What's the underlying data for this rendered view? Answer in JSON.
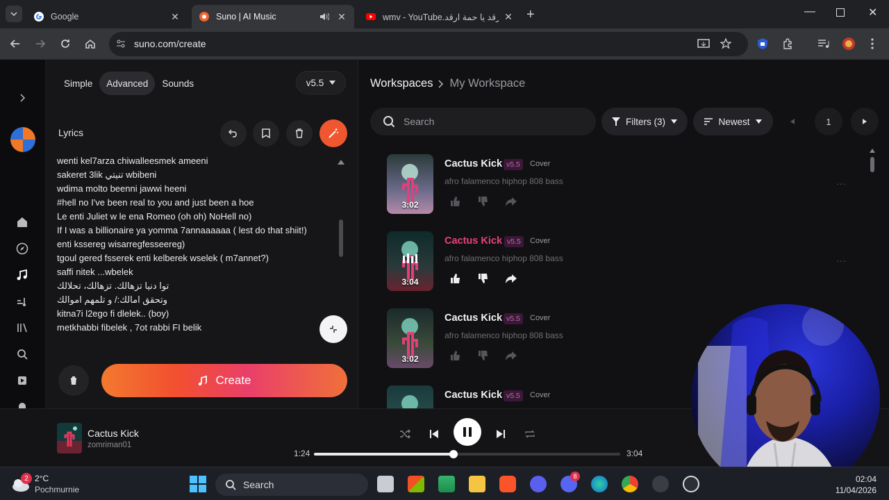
{
  "browser": {
    "tabs": [
      {
        "title": "Google",
        "active": false
      },
      {
        "title": "Suno | AI Music",
        "active": true
      },
      {
        "title": "wmv - YouTube.ارقد يا حمة ارقد",
        "active": false
      }
    ],
    "url": "suno.com/create"
  },
  "editor": {
    "modes": [
      "Simple",
      "Advanced",
      "Sounds"
    ],
    "active_mode": "Advanced",
    "version": "v5.5",
    "lyrics_label": "Lyrics",
    "lyrics_lines": [
      "wenti kel7arza chiwalleesmek ameeni",
      "sakeret 3lik تنيتي wbibeni",
      "wdima molto beenni jawwi heeni",
      "#hell no I've been real to you and just been a hoe",
      " Le enti Juliet w le ena Romeo (oh oh) NoHell no)",
      " If I was a billionaire ya yomma 7annaaaaaa ( lest do that shiit!)",
      "enti kssereg  wisarregfesseereg)",
      "tgoul gered fsserek enti kelberek wselek ( m7annet?)",
      "saffi nitek ...wbelek",
      "توا دنيا تزهالك. تزهالك، تحلالك",
      "وتحقق امالك:/ و تلمهم اموالك",
      " kitna7i l2ego fi dlelek.. (boy)",
      " metkhabbi fibelek  , 7ot rabbi FI belik"
    ],
    "create_label": "Create"
  },
  "workspace": {
    "breadcrumb_root": "Workspaces",
    "breadcrumb_current": "My Workspace",
    "search_placeholder": "Search",
    "filters_label": "Filters (3)",
    "sort_label": "Newest",
    "page": "1",
    "songs": [
      {
        "title": "Cactus Kick",
        "version": "v5.5",
        "tag": "Cover",
        "desc": "afro falamenco hiphop 808 bass",
        "duration": "3:02",
        "playing": false
      },
      {
        "title": "Cactus Kick",
        "version": "v5.5",
        "tag": "Cover",
        "desc": "afro falamenco hiphop 808 bass",
        "duration": "3:04",
        "playing": true
      },
      {
        "title": "Cactus Kick",
        "version": "v5.5",
        "tag": "Cover",
        "desc": "afro falamenco hiphop 808 bass",
        "duration": "3:02",
        "playing": false
      },
      {
        "title": "Cactus Kick",
        "version": "v5.5",
        "tag": "Cover",
        "desc": "",
        "duration": "",
        "playing": false
      }
    ]
  },
  "player": {
    "title": "Cactus Kick",
    "artist": "zomriman01",
    "current_time": "1:24",
    "total_time": "3:04",
    "progress_fraction": 0.456
  },
  "taskbar": {
    "weather_temp": "2°C",
    "weather_desc": "Pochmurnie",
    "weather_badge": "2",
    "search_label": "Search",
    "discord_badge": "8",
    "time": "02:04",
    "date": "11/04/2026"
  },
  "colors": {
    "accent_pink": "#e8407a",
    "create_gradient_start": "#f3792f",
    "create_gradient_end": "#ea3f6a",
    "version_tag": "#b66ea4"
  }
}
